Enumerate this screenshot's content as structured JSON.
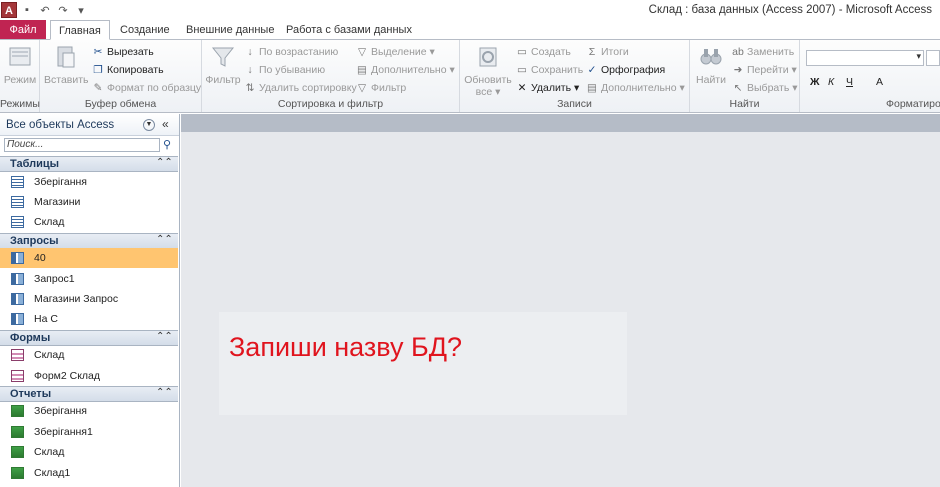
{
  "window": {
    "app_icon_letter": "A",
    "title": "Склад : база данных (Access 2007)  -  Microsoft Access"
  },
  "tabs": [
    "Файл",
    "Главная",
    "Создание",
    "Внешние данные",
    "Работа с базами данных"
  ],
  "ribbon": {
    "groups": {
      "modes": {
        "label": "Режимы",
        "view": "Режим"
      },
      "clipboard": {
        "label": "Буфер обмена",
        "paste": "Вставить",
        "cut": "Вырезать",
        "copy": "Копировать",
        "format_painter": "Формат по образцу"
      },
      "sort_filter": {
        "label": "Сортировка и фильтр",
        "filter": "Фильтр",
        "ascending": "По возрастанию",
        "descending": "По убыванию",
        "remove_sort": "Удалить сортировку",
        "selection": "Выделение",
        "advanced": "Дополнительно",
        "toggle_filter": "Фильтр"
      },
      "records": {
        "label": "Записи",
        "refresh": "Обновить",
        "refresh2": "все",
        "new": "Создать",
        "save": "Сохранить",
        "delete": "Удалить",
        "totals": "Итоги",
        "spelling": "Орфография",
        "more": "Дополнительно"
      },
      "find": {
        "label": "Найти",
        "find": "Найти",
        "replace": "Заменить",
        "goto": "Перейти",
        "select": "Выбрать"
      },
      "formatting": {
        "label": "Форматиров",
        "bold": "Ж",
        "italic": "К",
        "underline": "Ч",
        "font_color": "A"
      }
    }
  },
  "nav": {
    "title": "Все объекты Access",
    "search_placeholder": "Поиск...",
    "sections": [
      {
        "title": "Таблицы",
        "items": [
          "Зберігання",
          "Магазини",
          "Склад"
        ]
      },
      {
        "title": "Запросы",
        "items": [
          "40",
          "Запрос1",
          "Магазини Запрос",
          "На С"
        ]
      },
      {
        "title": "Формы",
        "items": [
          "Склад",
          "Форм2 Склад"
        ]
      },
      {
        "title": "Отчеты",
        "items": [
          "Зберігання",
          "Зберігання1",
          "Склад",
          "Склад1"
        ]
      }
    ]
  },
  "main": {
    "question": "Запиши назву БД?"
  },
  "colors": {
    "file_tab": "#c02452",
    "selected_item": "#ffc570",
    "question_text": "#e0141e"
  }
}
